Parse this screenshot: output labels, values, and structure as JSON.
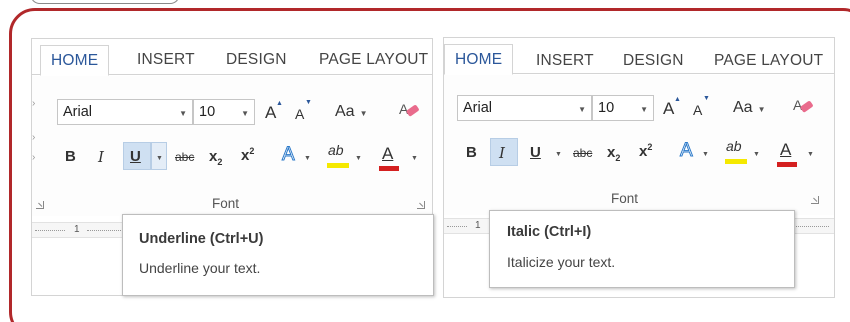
{
  "tabs": [
    "HOME",
    "INSERT",
    "DESIGN",
    "PAGE LAYOUT"
  ],
  "font_name": "Arial",
  "font_size": "10",
  "grow_font": "A",
  "shrink_font": "A",
  "change_case": "Aa",
  "bold": "B",
  "italic": "I",
  "underline": "U",
  "strikethrough": "abc",
  "subscript": "x",
  "subscript_sub": "2",
  "superscript": "x",
  "superscript_sup": "2",
  "text_effects": "A",
  "highlight": "ab",
  "font_color": "A",
  "group_label": "Font",
  "ruler_number": "1",
  "tooltips": {
    "underline": {
      "title": "Underline (Ctrl+U)",
      "desc": "Underline your text."
    },
    "italic": {
      "title": "Italic (Ctrl+I)",
      "desc": "Italicize your text."
    }
  },
  "colors": {
    "frame": "#b1282a",
    "accent": "#2b579a",
    "highlight": "#f5e900",
    "font_color": "#d42020",
    "hover": "#cfe0f2"
  }
}
